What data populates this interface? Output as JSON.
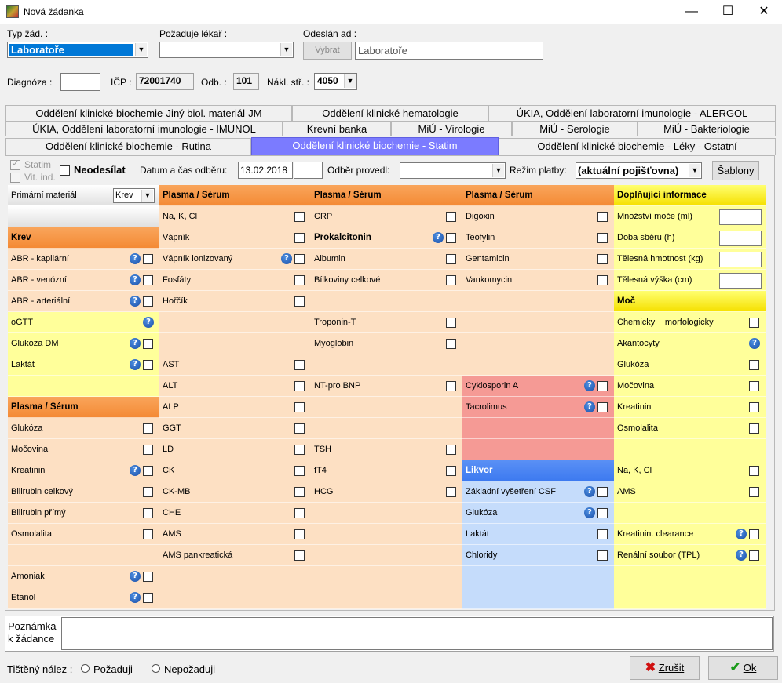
{
  "window": {
    "title": "Nová žádanka",
    "min": "—",
    "max": "☐",
    "close": "✕"
  },
  "top": {
    "typ_label": "Typ žád. :",
    "typ_value": "Laboratoře",
    "pozaduje_label": "Požaduje lékař :",
    "pozaduje_value": "",
    "odeslan_label": "Odeslán ad :",
    "vybrat_label": "Vybrat",
    "odeslan_value": "Laboratoře",
    "diagnoza_label": "Diagnóza :",
    "diagnoza_value": "",
    "icp_label": "IČP :",
    "icp_value": "72001740",
    "odb_label": "Odb. :",
    "odb_value": "101",
    "nakl_label": "Nákl. stř. :",
    "nakl_value": "4050"
  },
  "tabs": {
    "row1": [
      "Oddělení klinické biochemie-Jiný biol. materiál-JM",
      "Oddělení klinické hematologie",
      "ÚKIA, Oddělení laboratorní imunologie - ALERGOL"
    ],
    "row2": [
      "ÚKIA, Oddělení laboratorní imunologie - IMUNOL",
      "Krevní banka",
      "MiÚ - Virologie",
      "MiÚ - Serologie",
      "MiÚ - Bakteriologie"
    ],
    "row3": [
      "Oddělení klinické biochemie - Rutina",
      "Oddělení klinické biochemie - Statim",
      "Oddělení klinické biochemie - Léky - Ostatní"
    ]
  },
  "options": {
    "statim": "Statim",
    "vit_ind": "Vit. ind.",
    "neodesilat": "Neodesílat",
    "datum_label": "Datum a čas odběru:",
    "datum_value": "13.02.2018",
    "cas_value": "",
    "odber_label": "Odběr provedl:",
    "odber_value": "",
    "platba_label": "Režim platby:",
    "platba_value": "(aktuální pojišťovna)",
    "sablony": "Šablony"
  },
  "grid": {
    "col1": [
      {
        "t": "Primární materiál",
        "k": "prim"
      },
      {
        "t": "",
        "k": "blank"
      },
      {
        "t": "Krev",
        "k": "hdr"
      },
      {
        "t": "ABR - kapilární",
        "q": true,
        "c": true
      },
      {
        "t": "ABR - venózní",
        "q": true,
        "c": true
      },
      {
        "t": "ABR - arteriální",
        "q": true,
        "c": true
      },
      {
        "t": "oGTT",
        "q": true,
        "c": false
      },
      {
        "t": "Glukóza DM",
        "q": true,
        "c": true
      },
      {
        "t": "Laktát",
        "q": true,
        "c": true
      },
      {
        "t": "",
        "k": "blank"
      },
      {
        "t": "Plasma / Sérum",
        "k": "hdr"
      },
      {
        "t": "Glukóza",
        "c": true
      },
      {
        "t": "Močovina",
        "c": true
      },
      {
        "t": "Kreatinin",
        "q": true,
        "c": true
      },
      {
        "t": "Bilirubin celkový",
        "c": true
      },
      {
        "t": "Bilirubin přímý",
        "c": true
      },
      {
        "t": "Osmolalita",
        "c": true
      },
      {
        "t": "",
        "k": "blank"
      },
      {
        "t": "Amoniak",
        "q": true,
        "c": true
      },
      {
        "t": "Etanol",
        "q": true,
        "c": true
      }
    ],
    "primary_material_value": "Krev",
    "col2": [
      {
        "t": "Plasma / Sérum",
        "k": "hdr"
      },
      {
        "t": "Na, K, Cl",
        "c": true
      },
      {
        "t": "Vápník",
        "c": true
      },
      {
        "t": "Vápník ionizovaný",
        "q": true,
        "c": true
      },
      {
        "t": "Fosfáty",
        "c": true
      },
      {
        "t": "Hořčík",
        "c": true
      },
      {
        "t": ""
      },
      {
        "t": ""
      },
      {
        "t": "AST",
        "c": true
      },
      {
        "t": "ALT",
        "c": true
      },
      {
        "t": "ALP",
        "c": true
      },
      {
        "t": "GGT",
        "c": true
      },
      {
        "t": "LD",
        "c": true
      },
      {
        "t": "CK",
        "c": true
      },
      {
        "t": "CK-MB",
        "c": true
      },
      {
        "t": "CHE",
        "c": true
      },
      {
        "t": "AMS",
        "c": true
      },
      {
        "t": "AMS pankreatická",
        "c": true
      },
      {
        "t": ""
      },
      {
        "t": ""
      }
    ],
    "col3": [
      {
        "t": "Plasma / Sérum",
        "k": "hdr"
      },
      {
        "t": "CRP",
        "c": true
      },
      {
        "t": "Prokalcitonin",
        "q": true,
        "c": true,
        "b": true
      },
      {
        "t": "Albumin",
        "c": true
      },
      {
        "t": "Bílkoviny celkové",
        "c": true
      },
      {
        "t": ""
      },
      {
        "t": "Troponin-T",
        "c": true
      },
      {
        "t": "Myoglobin",
        "c": true
      },
      {
        "t": ""
      },
      {
        "t": "NT-pro BNP",
        "c": true
      },
      {
        "t": ""
      },
      {
        "t": ""
      },
      {
        "t": "TSH",
        "c": true
      },
      {
        "t": "fT4",
        "c": true
      },
      {
        "t": "HCG",
        "c": true
      },
      {
        "t": ""
      },
      {
        "t": ""
      },
      {
        "t": ""
      },
      {
        "t": ""
      },
      {
        "t": ""
      }
    ],
    "col4": [
      {
        "t": "Plasma / Sérum",
        "k": "hdr"
      },
      {
        "t": "Digoxin",
        "c": true
      },
      {
        "t": "Teofylin",
        "c": true
      },
      {
        "t": "Gentamicin",
        "c": true
      },
      {
        "t": "Vankomycin",
        "c": true
      },
      {
        "t": ""
      },
      {
        "t": ""
      },
      {
        "t": ""
      },
      {
        "t": ""
      },
      {
        "t": "Cyklosporin A",
        "q": true,
        "c": true,
        "z": "red"
      },
      {
        "t": "Tacrolimus",
        "q": true,
        "c": true,
        "z": "red"
      },
      {
        "t": "",
        "z": "red"
      },
      {
        "t": "",
        "z": "red"
      },
      {
        "t": "Likvor",
        "k": "hdrblue"
      },
      {
        "t": "Základní vyšetření CSF",
        "q": true,
        "c": true,
        "z": "blue"
      },
      {
        "t": "Glukóza",
        "q": true,
        "c": true,
        "z": "blue"
      },
      {
        "t": "Laktát",
        "c": true,
        "z": "blue"
      },
      {
        "t": "Chloridy",
        "c": true,
        "z": "blue"
      },
      {
        "t": "",
        "z": "blue"
      },
      {
        "t": "",
        "z": "blue"
      }
    ],
    "col5": [
      {
        "t": "Doplňující informace",
        "k": "hdryel"
      },
      {
        "t": "Množství moče (ml)",
        "i": true
      },
      {
        "t": "Doba sběru (h)",
        "i": true
      },
      {
        "t": "Tělesná hmotnost (kg)",
        "i": true
      },
      {
        "t": "Tělesná výška (cm)",
        "i": true
      },
      {
        "t": "Moč",
        "k": "hdryel"
      },
      {
        "t": "Chemicky + morfologicky",
        "c": true
      },
      {
        "t": "Akantocyty",
        "q": true,
        "c": false
      },
      {
        "t": "Glukóza",
        "c": true
      },
      {
        "t": "Močovina",
        "c": true
      },
      {
        "t": "Kreatinin",
        "c": true
      },
      {
        "t": "Osmolalita",
        "c": true
      },
      {
        "t": ""
      },
      {
        "t": "Na, K, Cl",
        "c": true
      },
      {
        "t": "AMS",
        "c": true
      },
      {
        "t": ""
      },
      {
        "t": "Kreatinin. clearance",
        "q": true,
        "c": true
      },
      {
        "t": "Renální soubor (TPL)",
        "q": true,
        "c": true
      },
      {
        "t": ""
      },
      {
        "t": ""
      }
    ]
  },
  "bottom": {
    "poznamka1": "Poznámka",
    "poznamka2": "k žádance",
    "tisteny": "Tištěný nález :",
    "pozaduji": "Požaduji",
    "nepozaduji": "Nepožaduji",
    "zrusit": "Zrušit",
    "ok": "Ok"
  },
  "colors": {
    "orange_hdr": "#f48a35",
    "peach": "#fde0c3",
    "yellow": "#ffff9a",
    "red": "#f59a95",
    "blue": "#c5dcfb",
    "blue_hdr": "#3d7af0",
    "tab_active": "#7b7bff"
  }
}
